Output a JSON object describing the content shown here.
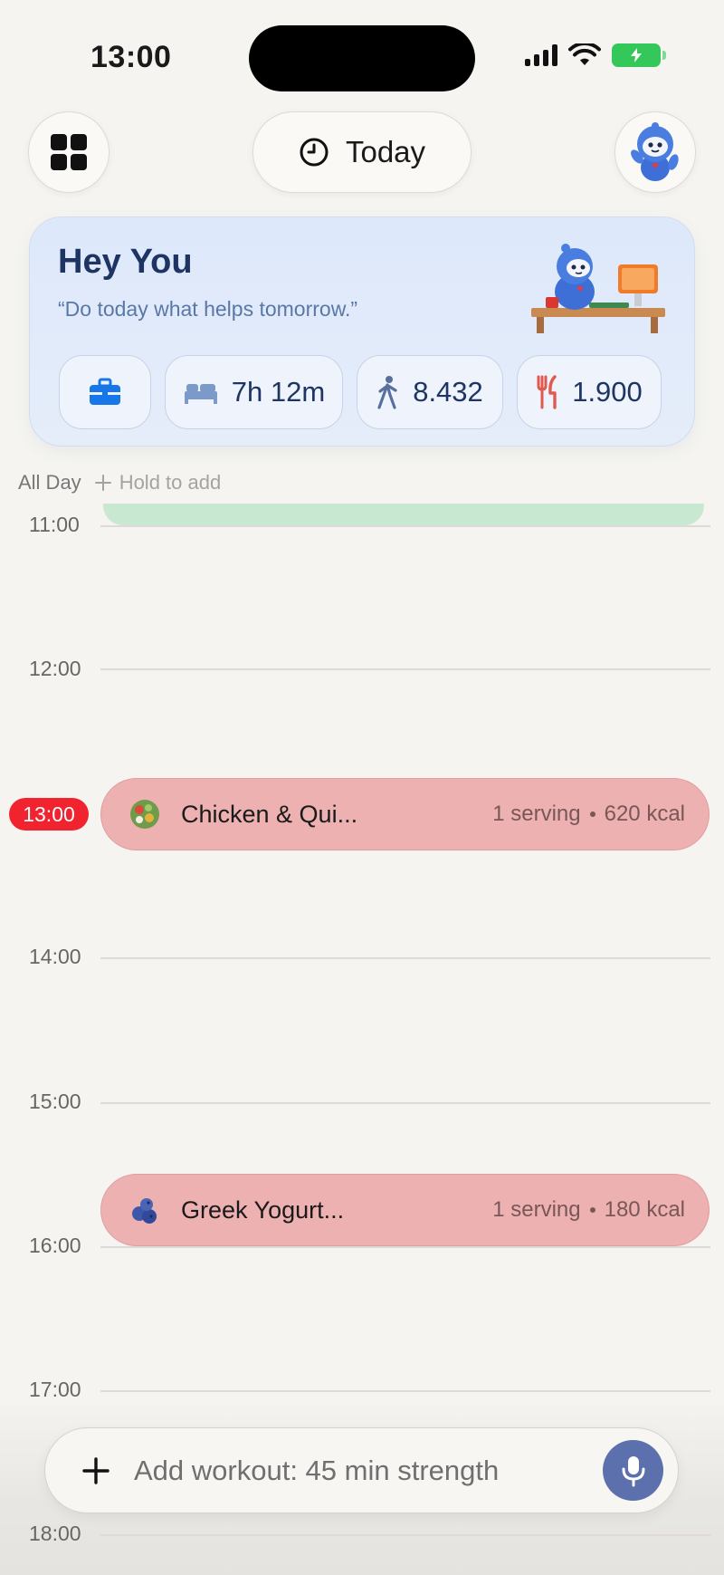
{
  "status_bar": {
    "time": "13:00"
  },
  "header": {
    "today_label": "Today"
  },
  "hero": {
    "title": "Hey You",
    "quote": "“Do today what helps tomorrow.”",
    "sleep": "7h 12m",
    "steps": "8.432",
    "calories": "1.900"
  },
  "all_day": {
    "label": "All Day",
    "hold_hint": "Hold to add"
  },
  "timeline": {
    "hours": [
      "11:00",
      "12:00",
      "14:00",
      "15:00",
      "16:00",
      "17:00",
      "18:00"
    ],
    "now_label": "13:00"
  },
  "events": [
    {
      "name": "Chicken & Qui...",
      "serving": "1 serving",
      "kcal": "620 kcal",
      "icon": "salad-icon"
    },
    {
      "name": "Greek Yogurt...",
      "serving": "1 serving",
      "kcal": "180 kcal",
      "icon": "blueberry-icon"
    }
  ],
  "composer": {
    "placeholder": "Add workout: 45 min strength"
  },
  "colors": {
    "accent": "#5b70ad",
    "meal_event": "#edb1b1",
    "now_badge": "#f0232f",
    "hero_title": "#1e3563"
  }
}
